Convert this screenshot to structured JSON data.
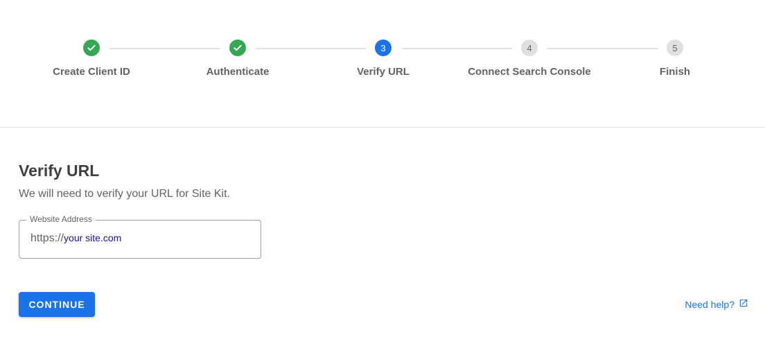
{
  "stepper": {
    "steps": [
      {
        "label": "Create Client ID",
        "state": "done",
        "number": ""
      },
      {
        "label": "Authenticate",
        "state": "done",
        "number": ""
      },
      {
        "label": "Verify URL",
        "state": "active",
        "number": "3"
      },
      {
        "label": "Connect Search Console",
        "state": "todo",
        "number": "4"
      },
      {
        "label": "Finish",
        "state": "todo",
        "number": "5"
      }
    ]
  },
  "main": {
    "title": "Verify URL",
    "description": "We will need to verify your URL for Site Kit.",
    "website_field": {
      "label": "Website Address",
      "prefix": "https://",
      "domain": "your site.com"
    },
    "continue_label": "CONTINUE",
    "help_label": "Need help?"
  },
  "colors": {
    "accent": "#1a73e8",
    "done": "#34a853",
    "todo": "#e0e0e0"
  },
  "icons": {
    "done_step": "checkmark-icon",
    "help": "external-link-icon"
  }
}
